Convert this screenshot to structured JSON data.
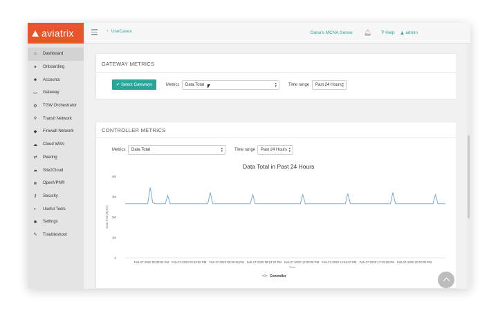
{
  "brand": {
    "name": "aviatrix",
    "color": "#e8552b"
  },
  "accent": "#2aa59a",
  "topbar": {
    "usecases": "UseCases",
    "service": "Dana's MCNA Sense",
    "help": "Help",
    "user": "admin"
  },
  "sidebar": {
    "items": [
      {
        "label": "Dashboard",
        "icon": "home-icon",
        "glyph": "⌂",
        "active": true
      },
      {
        "label": "Onboarding",
        "icon": "plane-icon",
        "glyph": "✈"
      },
      {
        "label": "Accounts",
        "icon": "users-icon",
        "glyph": "☻"
      },
      {
        "label": "Gateway",
        "icon": "monitor-icon",
        "glyph": "▭"
      },
      {
        "label": "TGW Orchestrator",
        "icon": "network-icon",
        "glyph": "⚙"
      },
      {
        "label": "Transit Network",
        "icon": "transit-icon",
        "glyph": "⚲"
      },
      {
        "label": "Firewall Network",
        "icon": "shield-icon",
        "glyph": "◆"
      },
      {
        "label": "Cloud WAN",
        "icon": "cloud-icon",
        "glyph": "☁"
      },
      {
        "label": "Peering",
        "icon": "peering-icon",
        "glyph": "⇄"
      },
      {
        "label": "Site2Cloud",
        "icon": "site2cloud-icon",
        "glyph": "☁"
      },
      {
        "label": "OpenVPN®",
        "icon": "vpn-icon",
        "glyph": "⊗"
      },
      {
        "label": "Security",
        "icon": "key-icon",
        "glyph": "⚷"
      },
      {
        "label": "Useful Tools",
        "icon": "tools-icon",
        "glyph": "◐"
      },
      {
        "label": "Settings",
        "icon": "gear-icon",
        "glyph": "✱"
      },
      {
        "label": "Troubleshoot",
        "icon": "wrench-icon",
        "glyph": "✎"
      }
    ]
  },
  "gateway_metrics": {
    "title": "GATEWAY METRICS",
    "select_button": "Select Gateways",
    "metrics_label": "Metrics",
    "metrics_value": "Data Total",
    "time_label": "Time range",
    "time_value": "Past 24 Hours"
  },
  "controller_metrics": {
    "title": "CONTROLLER METRICS",
    "metrics_label": "Metrics",
    "metrics_value": "Data Total",
    "time_label": "Time range",
    "time_value": "Past 24 Hours"
  },
  "chart_data": {
    "type": "line",
    "title": "Data Total in Past 24 Hours",
    "ylabel": "Data Total (Bytes)",
    "xlabel": "Time",
    "y_ticks": [
      "0",
      "1M",
      "2M",
      "3M",
      "4M"
    ],
    "ylim": [
      0,
      4000000
    ],
    "x_ticks": [
      "Feb-27-2020 00:33:00 PM",
      "Feb-27-2020 03:43:00 PM",
      "Feb-27-2020 06:38:40 PM",
      "Feb-27-2020 08:13:20 PM",
      "Feb-27-2020 12:00:00 PM",
      "Feb-27-2020 14:46:40 PM",
      "Feb-27-2020 17:33:20 PM",
      "Feb-27-2020 20:20:00 PM"
    ],
    "series": [
      {
        "name": "Controller",
        "color": "#6aa3d2",
        "values": [
          2.65,
          2.65,
          2.65,
          2.65,
          2.65,
          2.65,
          2.65,
          2.65,
          2.65,
          2.65,
          3.45,
          2.7,
          2.65,
          2.65,
          2.65,
          2.65,
          2.65,
          3.05,
          2.65,
          2.65,
          2.65,
          2.65,
          2.65,
          2.65,
          2.65,
          2.65,
          2.65,
          2.65,
          2.65,
          2.65,
          2.65,
          2.65,
          2.65,
          2.65,
          3.2,
          2.65,
          2.65,
          2.65,
          2.65,
          2.65,
          2.65,
          2.65,
          2.65,
          2.65,
          2.65,
          2.65,
          2.65,
          2.65,
          2.65,
          2.65,
          2.65,
          3.1,
          2.65,
          2.65,
          2.65,
          2.65,
          2.65,
          2.65,
          2.65,
          2.65,
          2.65,
          2.65,
          2.65,
          2.65,
          2.65,
          2.65,
          2.65,
          2.65,
          2.65,
          2.65,
          2.65,
          3.1,
          2.65,
          2.65,
          2.65,
          2.65,
          2.65,
          2.65,
          2.65,
          2.65,
          2.65,
          2.65,
          2.65,
          2.65,
          2.65,
          2.65,
          2.65,
          2.65,
          2.65,
          3.15,
          2.65,
          2.65,
          2.65,
          2.65,
          2.65,
          2.65,
          2.65,
          2.65,
          2.65,
          2.65,
          2.65,
          2.65,
          2.65,
          2.65,
          2.65,
          2.65,
          2.65,
          3.2,
          2.65,
          2.65,
          2.65,
          2.65,
          2.65,
          2.65,
          2.65,
          2.65,
          2.65,
          2.65,
          2.65,
          2.65,
          2.65,
          2.65,
          2.65,
          2.65,
          3.1,
          2.65,
          2.65,
          2.65,
          2.65
        ],
        "value_unit_multiplier": 1000000
      }
    ],
    "legend": [
      "Controller"
    ],
    "grid": false
  }
}
